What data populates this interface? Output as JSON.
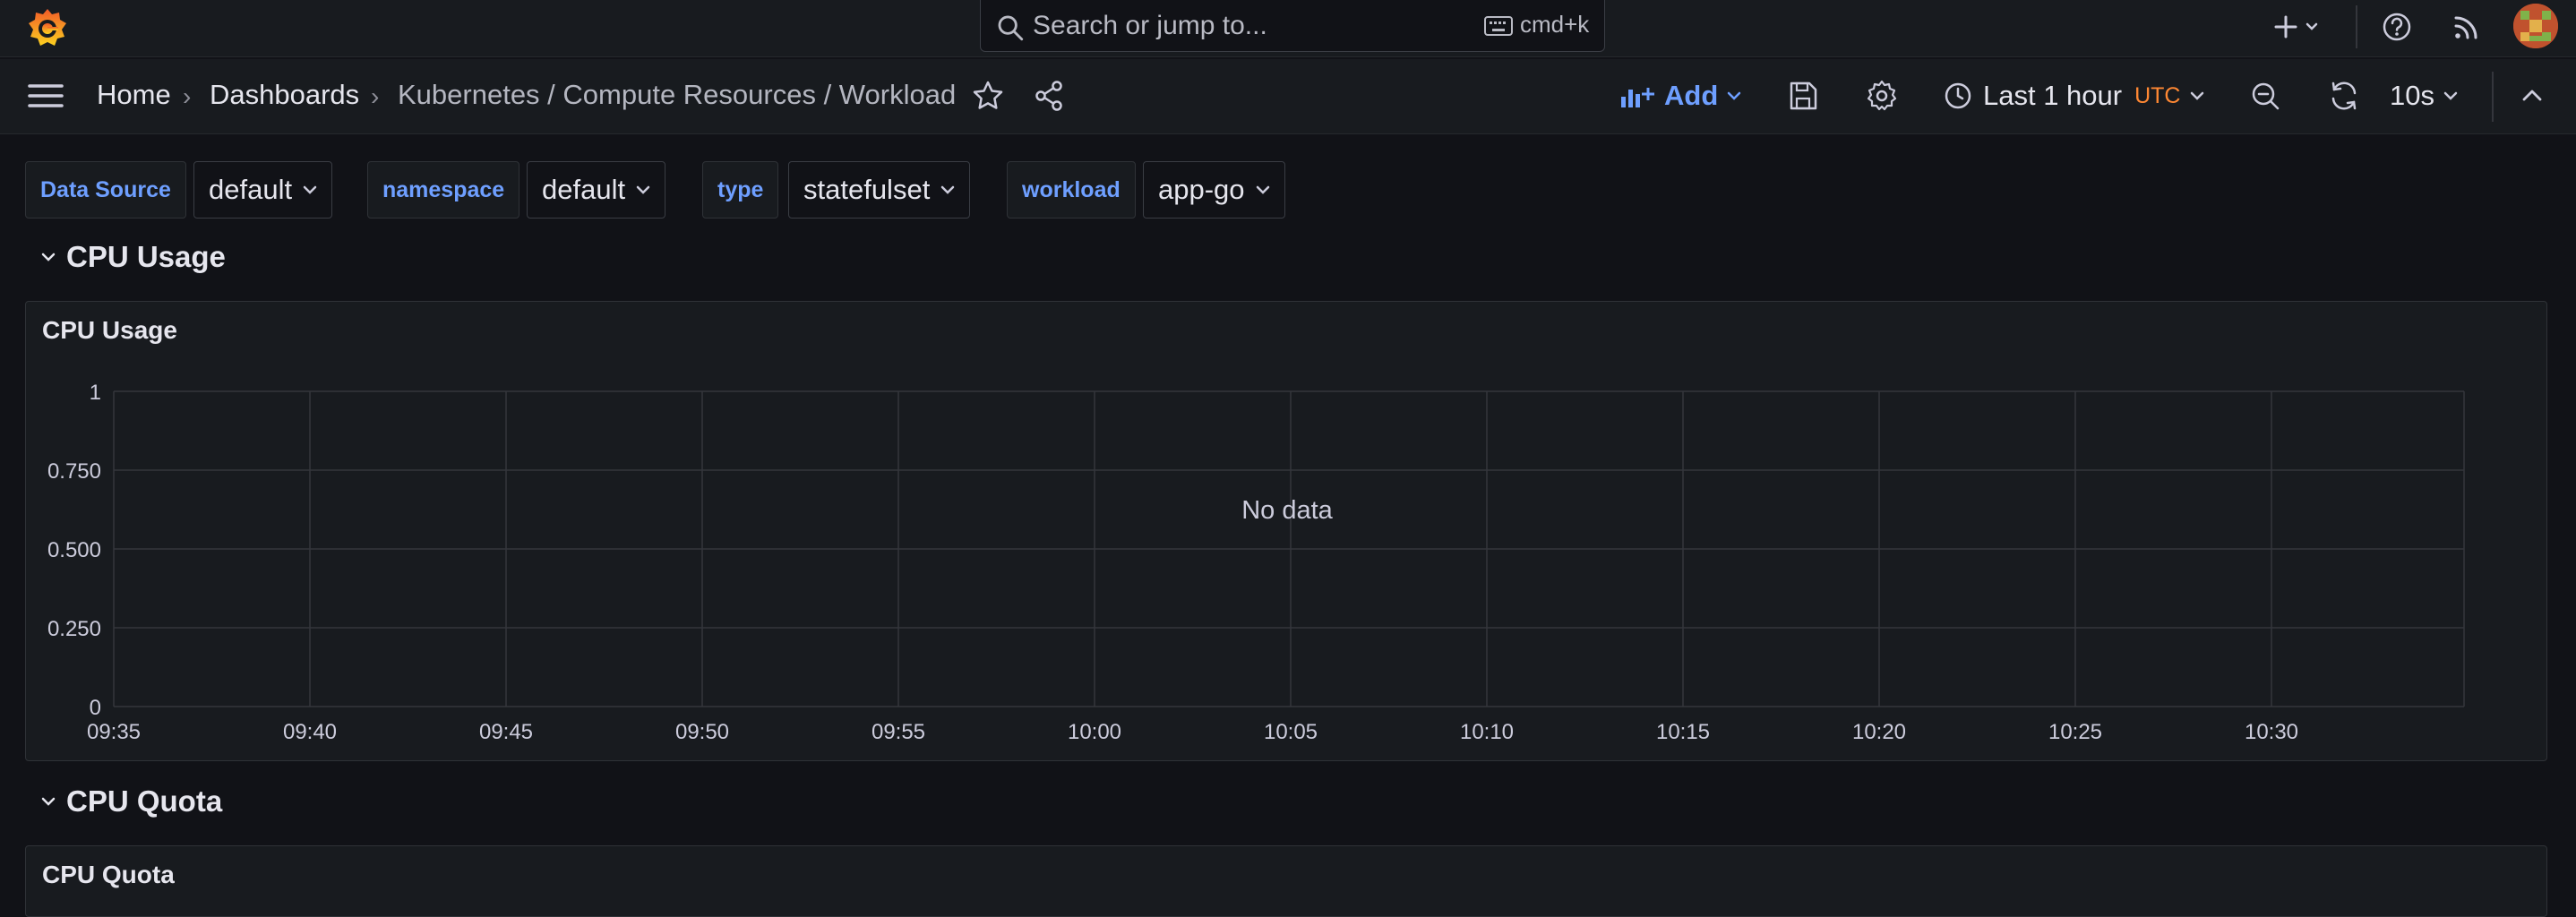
{
  "search": {
    "placeholder": "Search or jump to...",
    "shortcut": "cmd+k"
  },
  "breadcrumbs": [
    "Home",
    "Dashboards",
    "Kubernetes / Compute Resources / Workload"
  ],
  "toolbar": {
    "add_label": "Add",
    "time_range": "Last 1 hour",
    "timezone": "UTC",
    "refresh_interval": "10s"
  },
  "variables": [
    {
      "label": "Data Source",
      "value": "default"
    },
    {
      "label": "namespace",
      "value": "default"
    },
    {
      "label": "type",
      "value": "statefulset"
    },
    {
      "label": "workload",
      "value": "app-go"
    }
  ],
  "rows": [
    {
      "title": "CPU Usage",
      "panel_title": "CPU Usage"
    },
    {
      "title": "CPU Quota",
      "panel_title": "CPU Quota"
    }
  ],
  "chart_data": {
    "type": "line",
    "title": "CPU Usage",
    "message": "No data",
    "x_ticks": [
      "09:35",
      "09:40",
      "09:45",
      "09:50",
      "09:55",
      "10:00",
      "10:05",
      "10:10",
      "10:15",
      "10:20",
      "10:25",
      "10:30"
    ],
    "y_ticks": [
      "1",
      "0.750",
      "0.500",
      "0.250",
      "0"
    ],
    "ylim": [
      0,
      1
    ],
    "series": [],
    "grid": true
  },
  "colors": {
    "accent": "#6e9fff",
    "timezone": "#ff8833",
    "background": "#111217",
    "panel": "#181b1f"
  },
  "icons": [
    "grafana-logo-icon",
    "search-icon",
    "keyboard-icon",
    "plus-icon",
    "help-icon",
    "rss-icon",
    "menu-icon",
    "star-icon",
    "share-icon",
    "add-panel-icon",
    "save-icon",
    "settings-icon",
    "clock-icon",
    "zoom-out-icon",
    "refresh-icon",
    "collapse-icon"
  ]
}
